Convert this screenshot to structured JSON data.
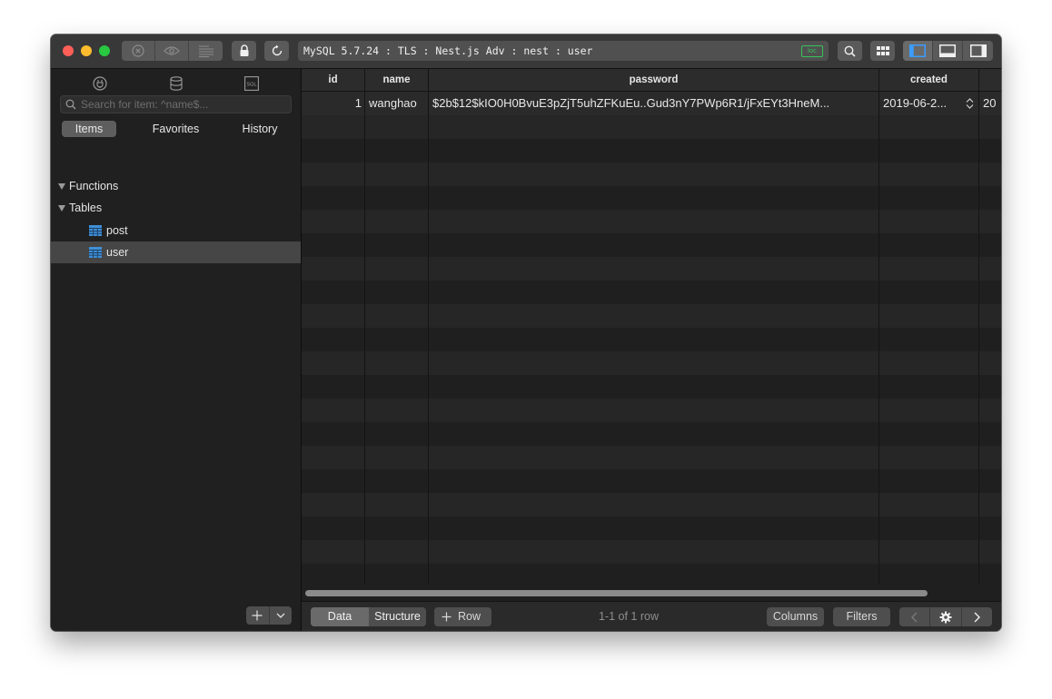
{
  "toolbar": {
    "connection_path": "MySQL 5.7.24 : TLS : Nest.js Adv : nest : user",
    "badge": "loc",
    "icons": [
      "close-circle-icon",
      "eye-icon",
      "console-log-icon",
      "lock-icon",
      "refresh-icon",
      "search-icon",
      "grid-icon",
      "left-panel-icon",
      "bottom-panel-icon",
      "right-panel-icon"
    ]
  },
  "sidebar": {
    "tab_icons": [
      "plug-icon",
      "database-icon",
      "sql-icon"
    ],
    "sql_tab_label": "SQL",
    "search_placeholder": "Search for item: ^name$...",
    "segments": [
      "Items",
      "Favorites",
      "History"
    ],
    "active_segment": "Items",
    "groups": [
      {
        "label": "Functions",
        "items": []
      },
      {
        "label": "Tables",
        "items": [
          {
            "label": "post",
            "selected": false
          },
          {
            "label": "user",
            "selected": true
          }
        ]
      }
    ]
  },
  "grid": {
    "columns": [
      "id",
      "name",
      "password",
      "created"
    ],
    "rows": [
      {
        "id": "1",
        "name": "wanghao",
        "password": "$2b$12$kIO0H0BvuE3pZjT5uhZFKuEu..Gud3nY7PWp6R1/jFxEYt3HneM...",
        "created": "2019-06-2...",
        "extra": "20"
      }
    ]
  },
  "bottombar": {
    "view_data": "Data",
    "view_structure": "Structure",
    "add_row": "Row",
    "row_info": "1-1 of 1 row",
    "columns_button": "Columns",
    "filters_button": "Filters"
  },
  "colors": {
    "window_bg": "#1e1e1e",
    "toolbar_bg": "#383838",
    "selected_row": "#464646",
    "badge_green": "#36c45a",
    "table_icon_blue": "#3f8fd6"
  }
}
